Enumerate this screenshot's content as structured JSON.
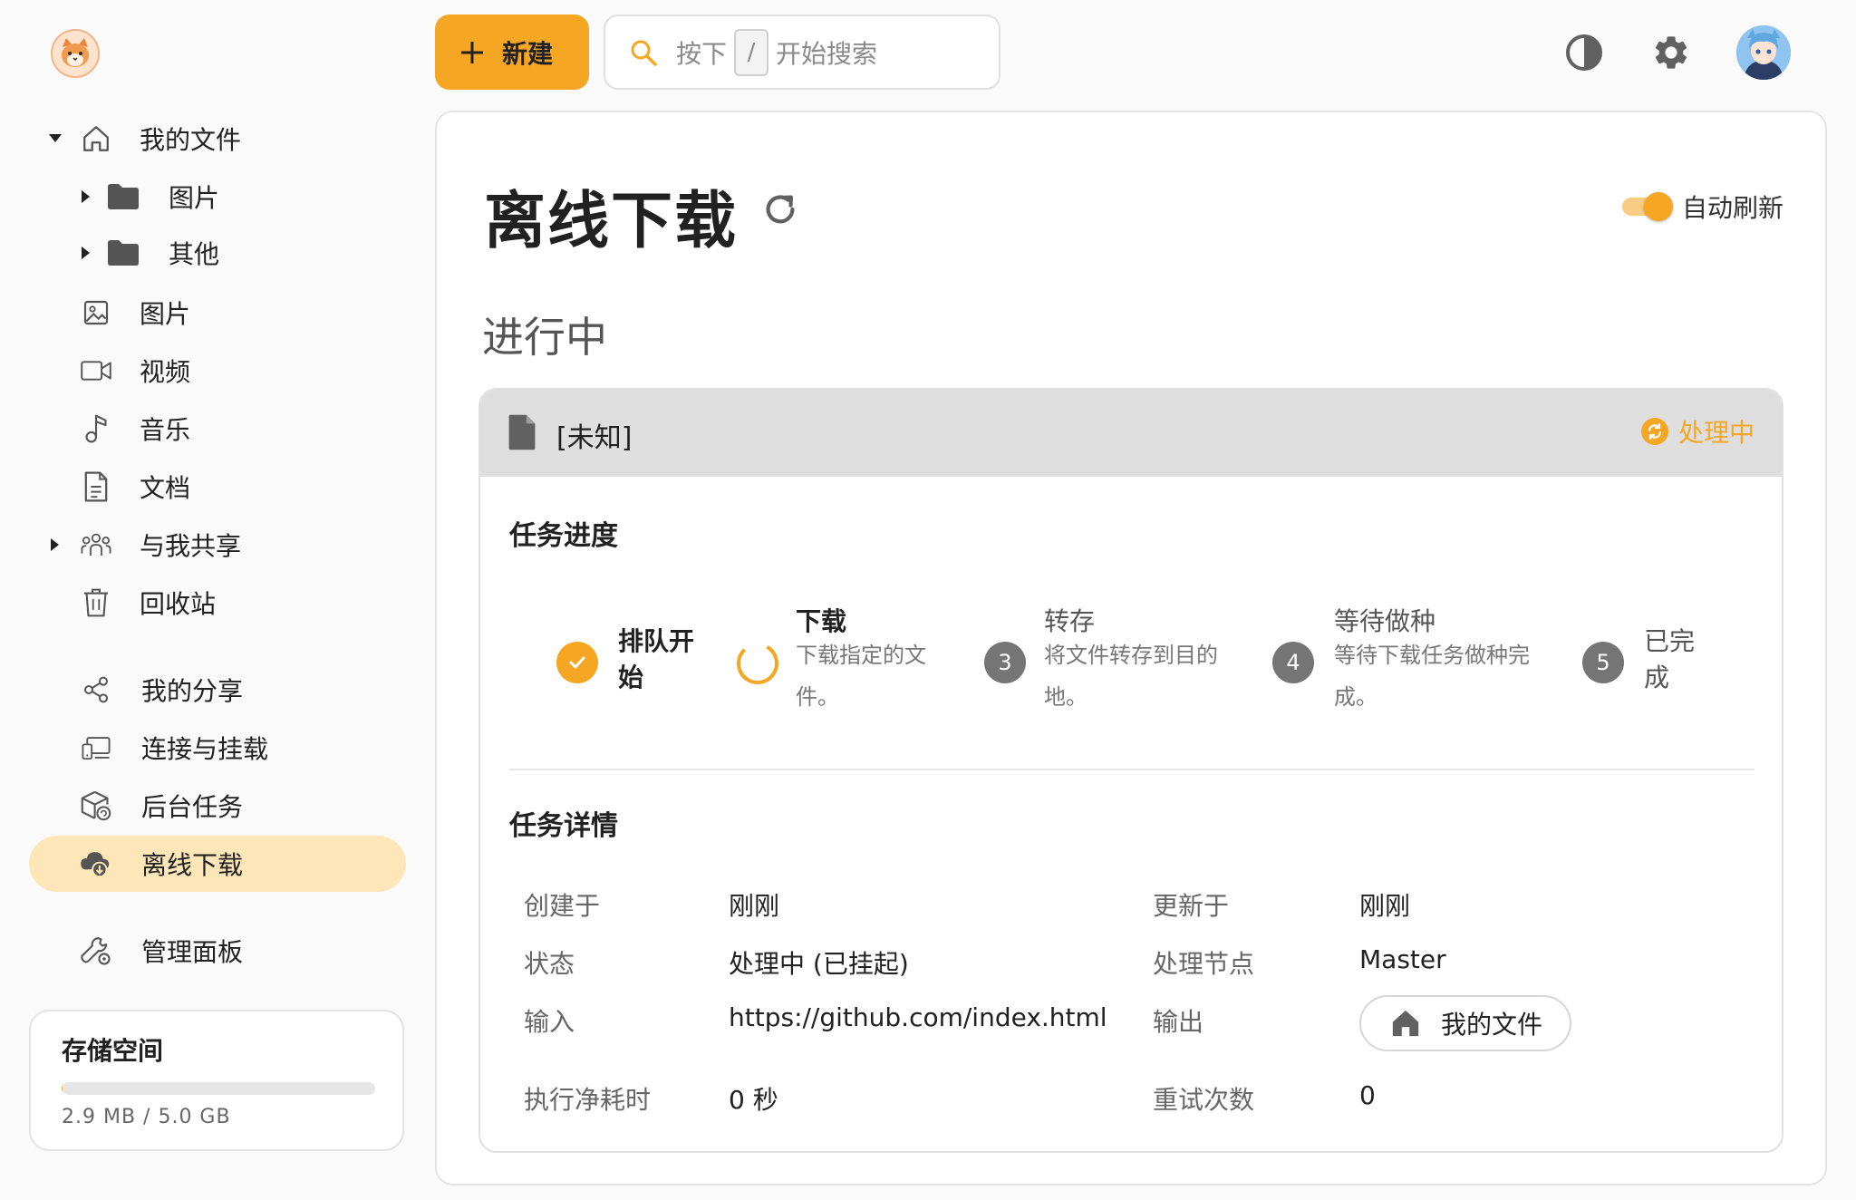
{
  "app": {
    "accent": "#f5a623",
    "active_bg": "#fde7b8"
  },
  "sidebar": {
    "items": [
      {
        "label": "我的文件",
        "icon": "home-icon",
        "expandable": true
      },
      {
        "label": "图片",
        "icon": "folder-icon",
        "expandable": true
      },
      {
        "label": "其他",
        "icon": "folder-icon",
        "expandable": true
      },
      {
        "label": "图片",
        "icon": "image-icon"
      },
      {
        "label": "视频",
        "icon": "video-icon"
      },
      {
        "label": "音乐",
        "icon": "music-icon"
      },
      {
        "label": "文档",
        "icon": "document-icon"
      },
      {
        "label": "与我共享",
        "icon": "people-icon",
        "expandable": true
      },
      {
        "label": "回收站",
        "icon": "trash-icon"
      },
      {
        "label": "我的分享",
        "icon": "share-icon"
      },
      {
        "label": "连接与挂载",
        "icon": "connect-icon"
      },
      {
        "label": "后台任务",
        "icon": "box-task-icon"
      },
      {
        "label": "离线下载",
        "icon": "cloud-download-icon",
        "active": true
      },
      {
        "label": "管理面板",
        "icon": "admin-tools-icon"
      }
    ],
    "storage": {
      "title": "存储空间",
      "usage_text": "2.9 MB / 5.0 GB",
      "used_fraction": 0.0006
    }
  },
  "topbar": {
    "new_label": "新建",
    "search_prefix": "按下",
    "search_key": "/",
    "search_suffix": "开始搜索"
  },
  "page": {
    "title": "离线下载",
    "auto_refresh_label": "自动刷新",
    "auto_refresh_on": true,
    "section_title": "进行中"
  },
  "task": {
    "name": "[未知]",
    "status": "处理中",
    "progress_title": "任务进度",
    "steps": [
      {
        "title": "排队开始",
        "desc": "",
        "state": "done"
      },
      {
        "title": "下载",
        "desc": "下载指定的文件。",
        "state": "active"
      },
      {
        "title": "转存",
        "desc": "将文件转存到目的地。",
        "state": "pending",
        "num": "3"
      },
      {
        "title": "等待做种",
        "desc": "等待下载任务做种完成。",
        "state": "pending",
        "num": "4"
      },
      {
        "title": "已完成",
        "desc": "",
        "state": "pending",
        "num": "5"
      }
    ],
    "details_title": "任务详情",
    "details": {
      "created_label": "创建于",
      "created_value": "刚刚",
      "updated_label": "更新于",
      "updated_value": "刚刚",
      "state_label": "状态",
      "state_value": "处理中 (已挂起)",
      "node_label": "处理节点",
      "node_value": "Master",
      "input_label": "输入",
      "input_value": "https://github.com/index.html",
      "output_label": "输出",
      "output_value": "我的文件",
      "elapsed_label": "执行净耗时",
      "elapsed_value": "0 秒",
      "retry_label": "重试次数",
      "retry_value": "0"
    }
  }
}
